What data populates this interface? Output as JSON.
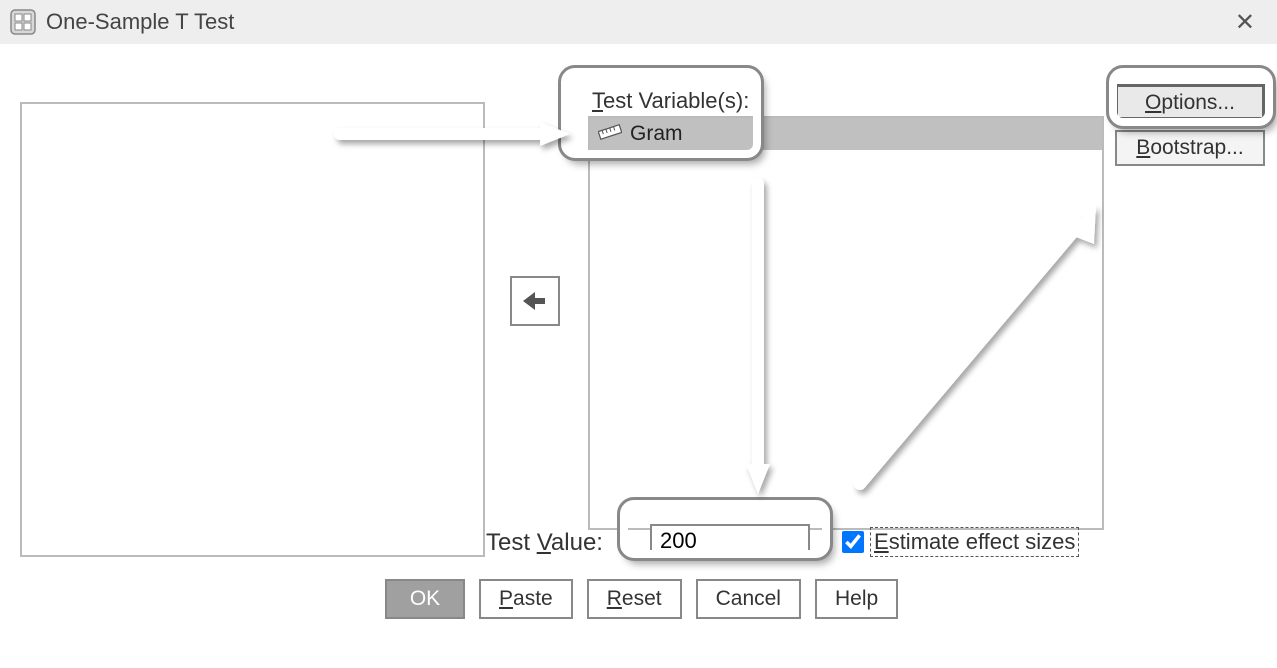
{
  "window": {
    "title": "One-Sample T Test"
  },
  "test_variables": {
    "label_prefix": "T",
    "label_rest": "est Variable(s):",
    "items": [
      {
        "name": "Gram"
      }
    ]
  },
  "test_value": {
    "label_prefix": "Test ",
    "label_u": "V",
    "label_rest": "alue:",
    "value": "200"
  },
  "effect_sizes": {
    "checked": true,
    "label_u": "E",
    "label_rest": "stimate effect sizes"
  },
  "right_buttons": {
    "options": {
      "u": "O",
      "rest": "ptions..."
    },
    "bootstrap": {
      "u": "B",
      "rest": "ootstrap..."
    }
  },
  "bottom_buttons": {
    "ok": "OK",
    "paste": {
      "u": "P",
      "rest": "aste"
    },
    "reset": {
      "u": "R",
      "rest": "eset"
    },
    "cancel": "Cancel",
    "help": "Help"
  }
}
